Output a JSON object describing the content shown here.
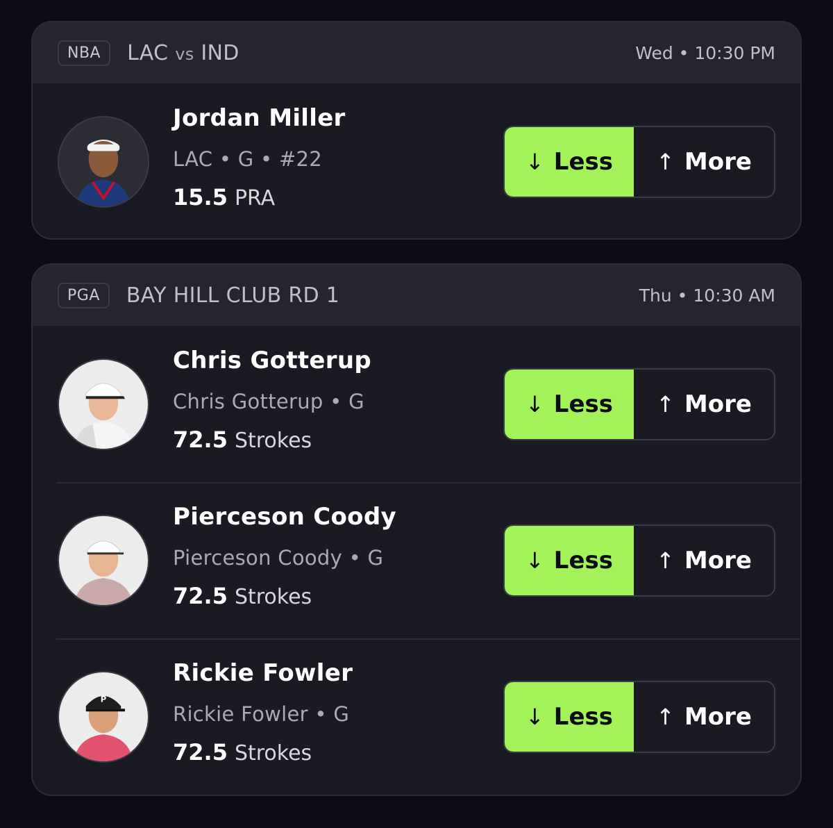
{
  "cards": [
    {
      "league": "NBA",
      "matchup_home": "LAC",
      "matchup_vs": "vs",
      "matchup_away": "IND",
      "time": "Wed • 10:30 PM",
      "players": [
        {
          "name": "Jordan Miller",
          "meta": "LAC • G • #22",
          "line": "15.5",
          "stat": "PRA",
          "less_label": "Less",
          "more_label": "More",
          "less_icon": "arrow-down-icon",
          "more_icon": "arrow-up-icon"
        }
      ]
    },
    {
      "league": "PGA",
      "matchup_title": "BAY HILL CLUB RD 1",
      "time": "Thu • 10:30 AM",
      "players": [
        {
          "name": "Chris Gotterup",
          "meta": "Chris Gotterup • G",
          "line": "72.5",
          "stat": "Strokes",
          "less_label": "Less",
          "more_label": "More"
        },
        {
          "name": "Pierceson Coody",
          "meta": "Pierceson Coody • G",
          "line": "72.5",
          "stat": "Strokes",
          "less_label": "Less",
          "more_label": "More"
        },
        {
          "name": "Rickie Fowler",
          "meta": "Rickie Fowler • G",
          "line": "72.5",
          "stat": "Strokes",
          "less_label": "Less",
          "more_label": "More"
        }
      ]
    }
  ],
  "colors": {
    "background": "#0b0c14",
    "card": "#1a1b22",
    "header": "#24252d",
    "accent_less": "#a3f25a",
    "text_muted": "#a9aab3"
  },
  "glyphs": {
    "down_arrow": "↓",
    "up_arrow": "↑"
  }
}
